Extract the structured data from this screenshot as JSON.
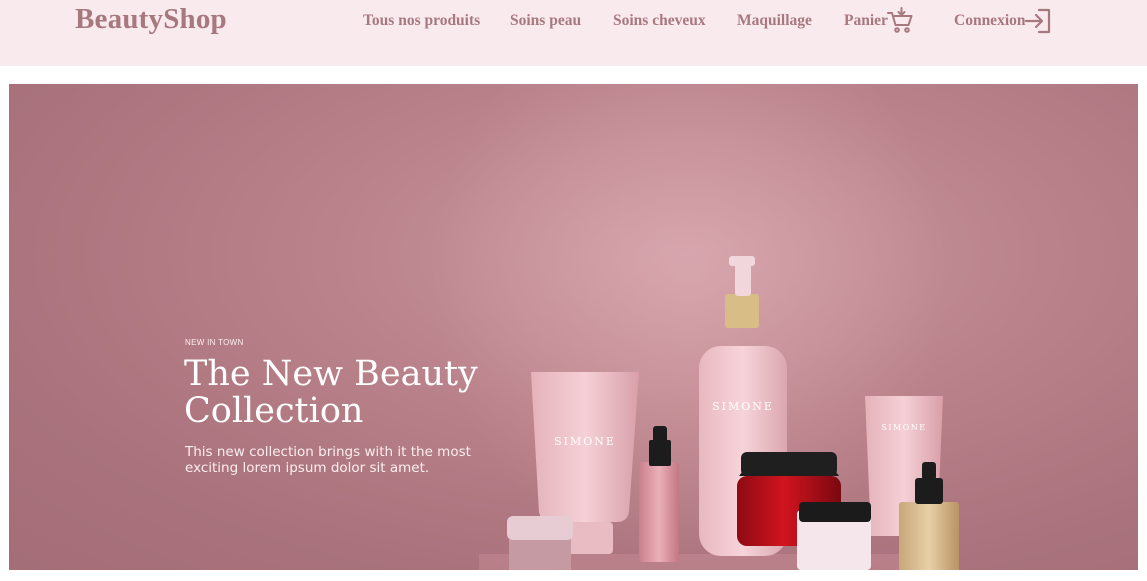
{
  "header": {
    "logo": "BeautyShop",
    "nav": [
      {
        "label": "Tous nos produits"
      },
      {
        "label": "Soins peau"
      },
      {
        "label": "Soins cheveux"
      },
      {
        "label": "Maquillage"
      },
      {
        "label": "Panier",
        "icon": "cart-icon"
      },
      {
        "label": "Connexion",
        "icon": "login-icon"
      }
    ]
  },
  "hero": {
    "kicker": "NEW IN TOWN",
    "title": "The New Beauty Collection",
    "description": "This new collection brings with it the most exciting lorem ipsum dolor sit amet.",
    "product_brand": "SIMONE"
  },
  "colors": {
    "nav_background": "#f9eaee",
    "brand_text": "#a8787f",
    "hero_background": "#b98189"
  }
}
